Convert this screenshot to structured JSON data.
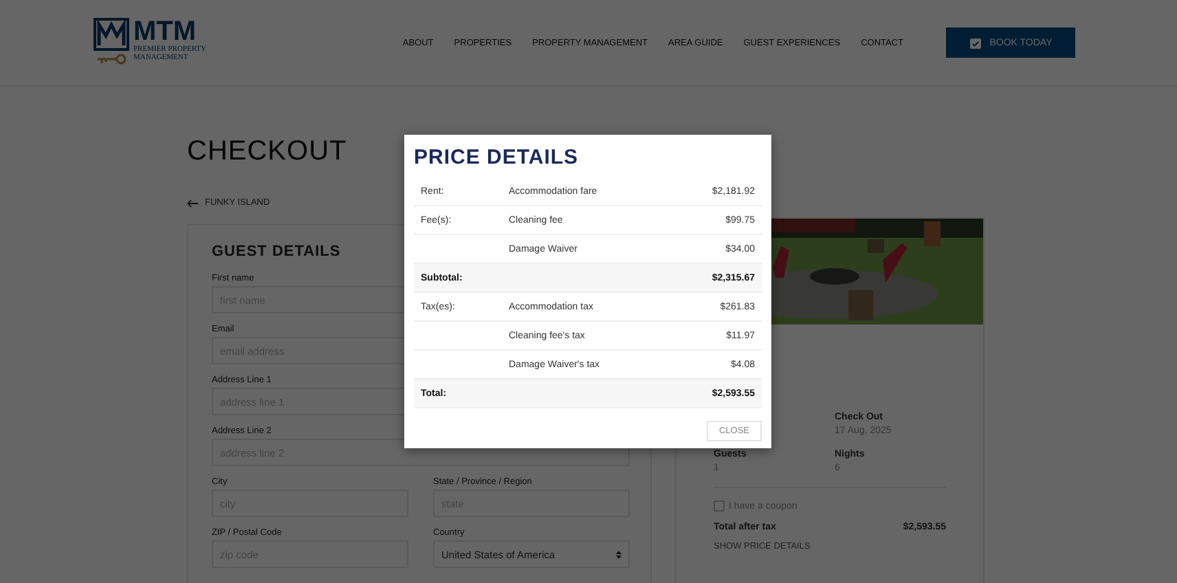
{
  "header": {
    "logo": {
      "name": "MTM",
      "tagline": "PREMIER PROPERTY MANAGEMENT"
    },
    "nav": [
      "ABOUT",
      "PROPERTIES",
      "PROPERTY MANAGEMENT",
      "AREA GUIDE",
      "GUEST EXPERIENCES",
      "CONTACT"
    ],
    "book_button": "BOOK TODAY"
  },
  "page_title": "CHECKOUT",
  "back_link": "FUNKY ISLAND",
  "guest_details": {
    "title": "GUEST DETAILS",
    "fields": [
      {
        "kind": "text",
        "label": "First name",
        "placeholder": "first name"
      },
      {
        "kind": "text",
        "label": "Email",
        "placeholder": "email address"
      },
      {
        "kind": "text",
        "label": "Address Line 1",
        "placeholder": "address line 1"
      },
      {
        "kind": "text",
        "label": "Address Line 2",
        "placeholder": "address line 2"
      },
      {
        "kind": "text",
        "label": "City",
        "placeholder": "city"
      },
      {
        "kind": "text",
        "label": "State / Province / Region",
        "placeholder": "state"
      },
      {
        "kind": "text",
        "label": "ZIP / Postal Code",
        "placeholder": "zip code"
      },
      {
        "kind": "select",
        "label": "Country",
        "value": "United States of America"
      }
    ]
  },
  "booking_summary": {
    "stats": [
      {
        "label": "Check Out",
        "value": "17 Aug, 2025"
      },
      {
        "label": "Guests",
        "value": "1"
      },
      {
        "label": "Nights",
        "value": "6"
      }
    ],
    "coupon": {
      "label": "I have a coupon",
      "checked": false
    },
    "total_label": "Total after tax",
    "total_value": "$2,593.55",
    "show_price_details": "SHOW PRICE DETAILS"
  },
  "modal": {
    "title": "PRICE DETAILS",
    "rows": [
      {
        "kind": "item",
        "label": "Rent:",
        "description": "Accommodation fare",
        "amount": "$2,181.92"
      },
      {
        "kind": "item",
        "label": "Fee(s):",
        "description": "Cleaning fee",
        "amount": "$99.75"
      },
      {
        "kind": "item",
        "description": "Damage Waiver",
        "amount": "$34.00"
      },
      {
        "kind": "sum",
        "label": "Subtotal:",
        "amount": "$2,315.67"
      },
      {
        "kind": "item",
        "label": "Tax(es):",
        "description": "Accommodation tax",
        "amount": "$261.83"
      },
      {
        "kind": "item",
        "description": "Cleaning fee's tax",
        "amount": "$11.97"
      },
      {
        "kind": "item",
        "description": "Damage Waiver's tax",
        "amount": "$4.08"
      },
      {
        "kind": "sum",
        "label": "Total:",
        "amount": "$2,593.55"
      }
    ],
    "close": "CLOSE"
  }
}
